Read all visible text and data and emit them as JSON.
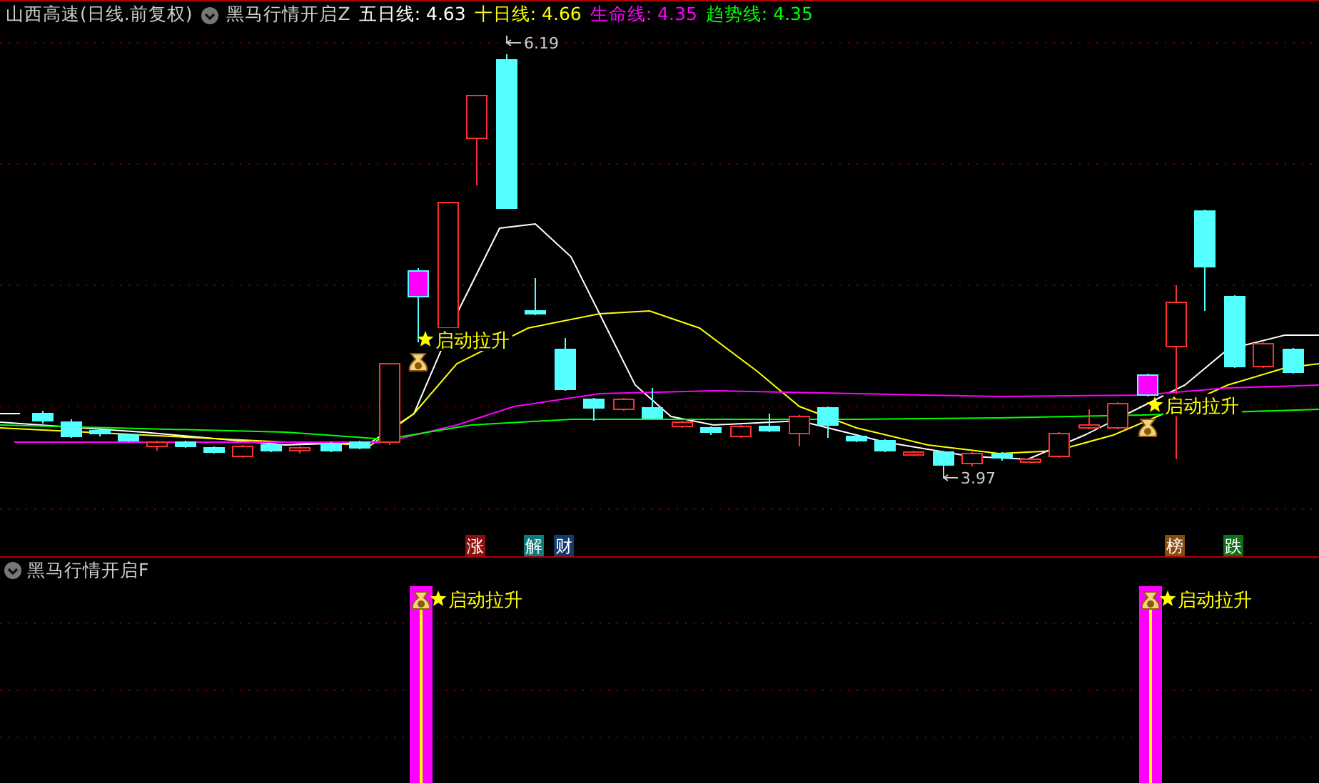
{
  "title": "山西高速(日线.前复权)",
  "indicator_name": "黑马行情开启Z",
  "ma_readings": [
    {
      "label": "五日线: 4.63",
      "color": "#ffffff"
    },
    {
      "label": "十日线: 4.66",
      "color": "#ffff00"
    },
    {
      "label": "生命线: 4.35",
      "color": "#ff00ff"
    },
    {
      "label": "趋势线: 4.35",
      "color": "#00ff00"
    }
  ],
  "price_marks": [
    {
      "kind": "high",
      "text": "6.19"
    },
    {
      "kind": "low",
      "text": "3.97"
    }
  ],
  "signals": [
    {
      "text": "启动拉升"
    },
    {
      "text": "启动拉升"
    }
  ],
  "badges": [
    {
      "text": "涨",
      "color": "#8b1010"
    },
    {
      "text": "解",
      "color": "#0f7a7a"
    },
    {
      "text": "财",
      "color": "#123a6e"
    },
    {
      "text": "榜",
      "color": "#8a4a0a"
    },
    {
      "text": "跌",
      "color": "#0f6e1a"
    }
  ],
  "sub_panel": {
    "title": "黑马行情开启F",
    "signals": [
      {
        "text": "启动拉升"
      },
      {
        "text": "启动拉升"
      }
    ]
  }
}
